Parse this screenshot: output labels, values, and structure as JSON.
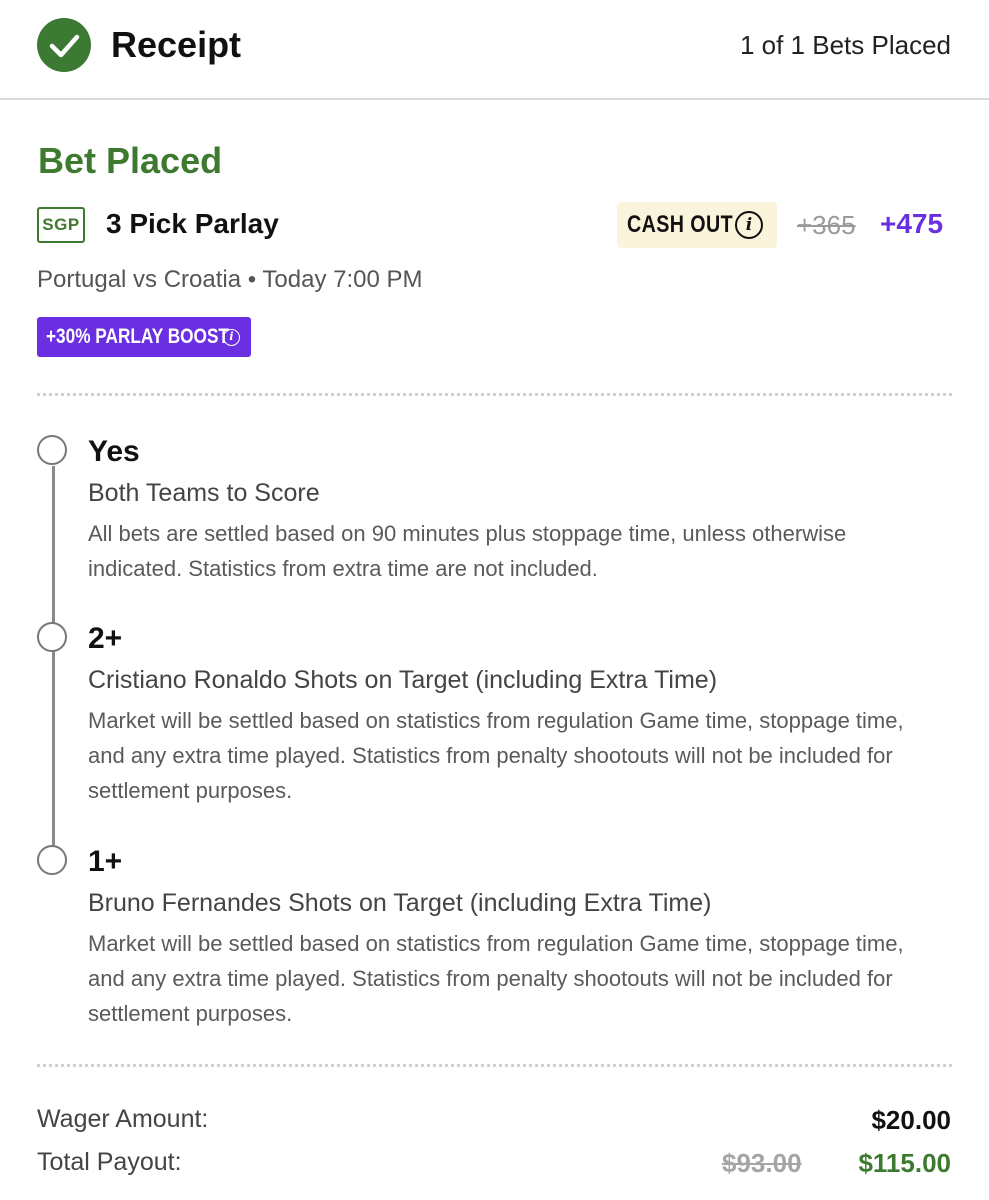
{
  "header": {
    "title": "Receipt",
    "bets_count": "1 of 1 Bets Placed"
  },
  "bet": {
    "status": "Bet Placed",
    "type_badge": "SGP",
    "title": "3 Pick Parlay",
    "cash_out_label": "CASH OUT",
    "odds_old": "+365",
    "odds_new": "+475",
    "match": "Portugal vs Croatia",
    "separator": "•",
    "time": "Today 7:00 PM",
    "boost_label": "+30% PARLAY BOOST",
    "legs": [
      {
        "pick": "Yes",
        "market": "Both Teams to Score",
        "description": "All bets are settled based on 90 minutes plus stoppage time, unless otherwise indicated. Statistics from extra time are not included."
      },
      {
        "pick": "2+",
        "market": "Cristiano Ronaldo Shots on Target (including Extra Time)",
        "description": "Market will be settled based on statistics from regulation Game time, stoppage time, and any extra time played. Statistics from penalty shootouts will not be included for settlement purposes."
      },
      {
        "pick": "1+",
        "market": "Bruno Fernandes Shots on Target (including Extra Time)",
        "description": "Market will be settled based on statistics from regulation Game time, stoppage time, and any extra time played. Statistics from penalty shootouts will not be included for settlement purposes."
      }
    ]
  },
  "summary": {
    "wager_label": "Wager Amount:",
    "wager_value": "$20.00",
    "payout_label": "Total Payout:",
    "payout_old": "$93.00",
    "payout_new": "$115.00"
  },
  "colors": {
    "success_green": "#3d7a2f",
    "boost_purple": "#6a2fe0",
    "cashout_bg": "#fbf4dc"
  },
  "icons": [
    "check-circle-icon",
    "info-icon",
    "timeline-circle-icon"
  ]
}
